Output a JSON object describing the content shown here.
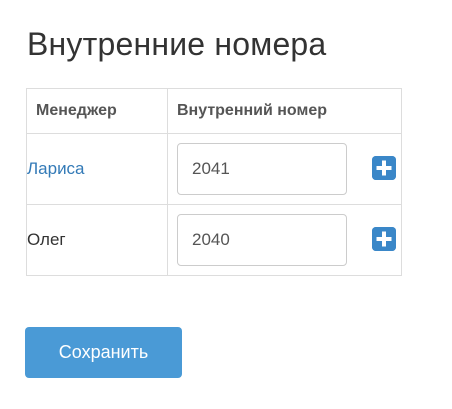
{
  "page": {
    "title": "Внутренние номера"
  },
  "table": {
    "headers": {
      "manager": "Менеджер",
      "extension": "Внутренний номер"
    },
    "rows": [
      {
        "manager": "Лариса",
        "manager_is_link": true,
        "extension": "2041",
        "add_icon": "plus-square-icon"
      },
      {
        "manager": "Олег",
        "manager_is_link": false,
        "extension": "2040",
        "add_icon": "plus-square-icon"
      }
    ]
  },
  "actions": {
    "save_label": "Сохранить"
  },
  "colors": {
    "link": "#337ab7",
    "accent": "#3a87c8",
    "save_button": "#4a9ad6",
    "border": "#dddddd"
  }
}
